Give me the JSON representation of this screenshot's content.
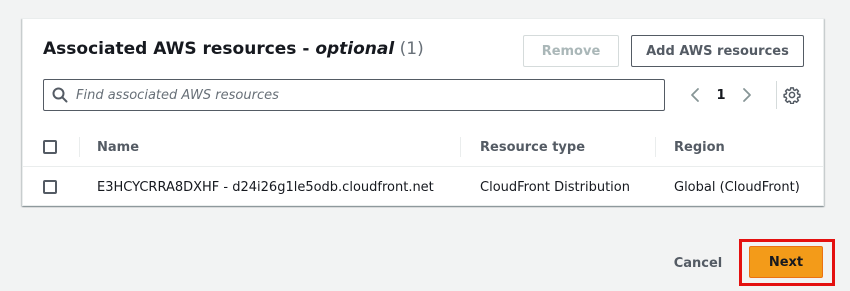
{
  "panel": {
    "title_main": "Associated AWS resources - ",
    "title_optional": "optional",
    "title_count": " (1)",
    "remove_label": "Remove",
    "add_label": "Add AWS resources"
  },
  "search": {
    "placeholder": "Find associated AWS resources",
    "value": ""
  },
  "pagination": {
    "current_page": "1"
  },
  "table": {
    "headers": {
      "name": "Name",
      "resource_type": "Resource type",
      "region": "Region"
    },
    "rows": [
      {
        "name": "E3HCYCRRA8DXHF - d24i26g1le5odb.cloudfront.net",
        "resource_type": "CloudFront Distribution",
        "region": "Global (CloudFront)"
      }
    ]
  },
  "footer": {
    "cancel_label": "Cancel",
    "next_label": "Next"
  },
  "colors": {
    "primary_button": "#f39b19",
    "highlight_box": "#e4100f",
    "page_background": "#f2f3f3"
  },
  "icons": {
    "search": "search-icon",
    "prev": "chevron-left-icon",
    "next": "chevron-right-icon",
    "settings": "gear-icon"
  }
}
